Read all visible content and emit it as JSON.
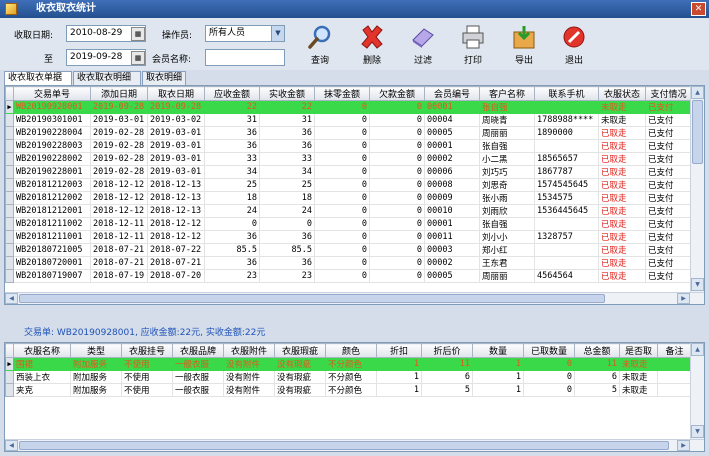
{
  "window": {
    "title": "收衣取衣统计"
  },
  "filters": {
    "date_label": "收取日期:",
    "date_from": "2010-08-29",
    "to_label": "至",
    "date_to": "2019-09-28",
    "operator_label": "操作员:",
    "operator_value": "所有人员",
    "member_label": "会员名称:",
    "member_value": ""
  },
  "toolbar": {
    "query": "查询",
    "delete": "删除",
    "filter": "过滤",
    "print": "打印",
    "export": "导出",
    "exit": "退出"
  },
  "tabs": [
    "收衣取衣单据",
    "收衣取衣明细",
    "取衣明细"
  ],
  "orders": {
    "columns": [
      "交易单号",
      "添加日期",
      "取衣日期",
      "应收金额",
      "实收金额",
      "抹零金额",
      "欠款金额",
      "会员编号",
      "客户名称",
      "联系手机",
      "衣服状态",
      "支付情况"
    ],
    "rows": [
      [
        "WB20190928001",
        "2019-09-28",
        "2019-09-28",
        "22",
        "22",
        "0",
        "0",
        "00001",
        "张自强",
        "",
        "未取走",
        "已支付"
      ],
      [
        "WB20190301001",
        "2019-03-01",
        "2019-03-02",
        "31",
        "31",
        "0",
        "0",
        "00004",
        "周晓青",
        "1788988****",
        "未取走",
        "已支付"
      ],
      [
        "WB20190228004",
        "2019-02-28",
        "2019-03-01",
        "36",
        "36",
        "0",
        "0",
        "00005",
        "周丽丽",
        "1890000",
        "已取走",
        "已支付"
      ],
      [
        "WB20190228003",
        "2019-02-28",
        "2019-03-01",
        "36",
        "36",
        "0",
        "0",
        "00001",
        "张自强",
        "",
        "已取走",
        "已支付"
      ],
      [
        "WB20190228002",
        "2019-02-28",
        "2019-03-01",
        "33",
        "33",
        "0",
        "0",
        "00002",
        "小二黑",
        "18565657",
        "已取走",
        "已支付"
      ],
      [
        "WB20190228001",
        "2019-02-28",
        "2019-03-01",
        "34",
        "34",
        "0",
        "0",
        "00006",
        "刘巧巧",
        "1867787",
        "已取走",
        "已支付"
      ],
      [
        "WB20181212003",
        "2018-12-12",
        "2018-12-13",
        "25",
        "25",
        "0",
        "0",
        "00008",
        "刘思奇",
        "1574545645",
        "已取走",
        "已支付"
      ],
      [
        "WB20181212002",
        "2018-12-12",
        "2018-12-13",
        "18",
        "18",
        "0",
        "0",
        "00009",
        "张小雨",
        "1534575",
        "已取走",
        "已支付"
      ],
      [
        "WB20181212001",
        "2018-12-12",
        "2018-12-13",
        "24",
        "24",
        "0",
        "0",
        "00010",
        "刘雨欣",
        "1536445645",
        "已取走",
        "已支付"
      ],
      [
        "WB20181211002",
        "2018-12-11",
        "2018-12-12",
        "0",
        "0",
        "0",
        "0",
        "00001",
        "张自强",
        "",
        "已取走",
        "已支付"
      ],
      [
        "WB20181211001",
        "2018-12-11",
        "2018-12-12",
        "36",
        "36",
        "0",
        "0",
        "00011",
        "刘小小",
        "1328757",
        "已取走",
        "已支付"
      ],
      [
        "WB20180721005",
        "2018-07-21",
        "2018-07-22",
        "85.5",
        "85.5",
        "0",
        "0",
        "00003",
        "郑小红",
        "",
        "已取走",
        "已支付"
      ],
      [
        "WB20180720001",
        "2018-07-21",
        "2018-07-21",
        "36",
        "36",
        "0",
        "0",
        "00002",
        "王东君",
        "",
        "已取走",
        "已支付"
      ],
      [
        "WB20180719007",
        "2018-07-19",
        "2018-07-20",
        "23",
        "23",
        "0",
        "0",
        "00005",
        "周丽丽",
        "4564564",
        "已取走",
        "已支付"
      ]
    ]
  },
  "summary": "交易单: WB20190928001, 应收金额:22元, 实收金额:22元",
  "items": {
    "columns": [
      "衣服名称",
      "类型",
      "衣服挂号",
      "衣服品牌",
      "衣服附件",
      "衣服瑕疵",
      "颜色",
      "折扣",
      "折后价",
      "数量",
      "已取数量",
      "总金额",
      "是否取",
      "备注"
    ],
    "rows": [
      [
        "围裙",
        "附加服务",
        "不使用",
        "一般衣服",
        "没有附件",
        "没有瑕疵",
        "不分颜色",
        "1",
        "11",
        "1",
        "0",
        "11",
        "未取走",
        ""
      ],
      [
        "西装上衣",
        "附加服务",
        "不使用",
        "一般衣服",
        "没有附件",
        "没有瑕疵",
        "不分颜色",
        "1",
        "6",
        "1",
        "0",
        "6",
        "未取走",
        ""
      ],
      [
        "夹克",
        "附加服务",
        "不使用",
        "一般衣服",
        "没有附件",
        "没有瑕疵",
        "不分颜色",
        "1",
        "5",
        "1",
        "0",
        "5",
        "未取走",
        ""
      ]
    ]
  },
  "colors": {
    "selected_row": "#39d94a",
    "selected_text": "#e05a1a",
    "status_red": "#e0201a",
    "summary_blue": "#1f52b8"
  },
  "icons": {
    "query": "magnifier-icon",
    "delete": "red-x-icon",
    "filter": "eraser-icon",
    "print": "printer-icon",
    "export": "export-icon",
    "exit": "exit-icon"
  }
}
